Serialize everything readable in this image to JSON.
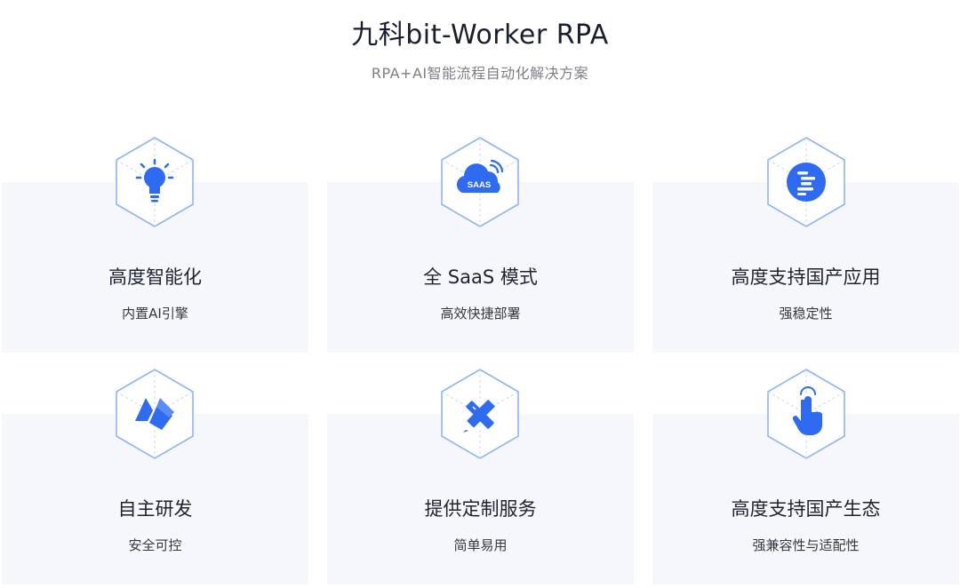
{
  "header": {
    "title": "九科bit-Worker RPA",
    "subtitle": "RPA+AI智能流程自动化解决方案"
  },
  "features": [
    {
      "title": "高度智能化",
      "desc": "内置AI引擎",
      "icon": "lightbulb-icon"
    },
    {
      "title": "全 SaaS 模式",
      "desc": "高效快捷部署",
      "icon": "saas-cloud-icon",
      "icon_text": "SAAS"
    },
    {
      "title": "高度支持国产应用",
      "desc": "强稳定性",
      "icon": "code-lines-icon"
    },
    {
      "title": "自主研发",
      "desc": "安全可控",
      "icon": "brand-logo-icon"
    },
    {
      "title": "提供定制服务",
      "desc": "简单易用",
      "icon": "pencil-ruler-icon"
    },
    {
      "title": "高度支持国产生态",
      "desc": "强兼容性与适配性",
      "icon": "hand-pointer-icon"
    }
  ],
  "colors": {
    "accent": "#2f6bf0",
    "hex_fill": "#ffffff",
    "hex_stroke": "#8fb4f5",
    "card_bg": "#f5f7fb"
  }
}
